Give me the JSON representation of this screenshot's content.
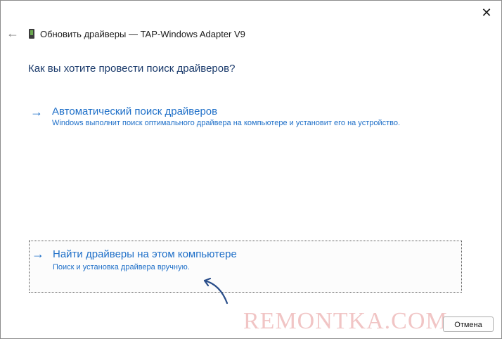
{
  "window": {
    "close_glyph": "✕",
    "back_glyph": "←",
    "title": "Обновить драйверы — TAP-Windows Adapter V9"
  },
  "question": "Как вы хотите провести поиск драйверов?",
  "options": [
    {
      "arrow": "→",
      "title": "Автоматический поиск драйверов",
      "description": "Windows выполнит поиск оптимального драйвера на компьютере и установит его на устройство."
    },
    {
      "arrow": "→",
      "title": "Найти драйверы на этом компьютере",
      "description": "Поиск и установка драйвера вручную."
    }
  ],
  "watermark": "REMONTKA.COM",
  "buttons": {
    "cancel": "Отмена"
  },
  "colors": {
    "link_blue": "#1e6fc8",
    "heading_blue": "#1a3a6b",
    "pointer_blue": "#2a4e8a"
  },
  "icons": {
    "device": "network-adapter-icon",
    "pointer": "curved-pointer-arrow-icon"
  }
}
